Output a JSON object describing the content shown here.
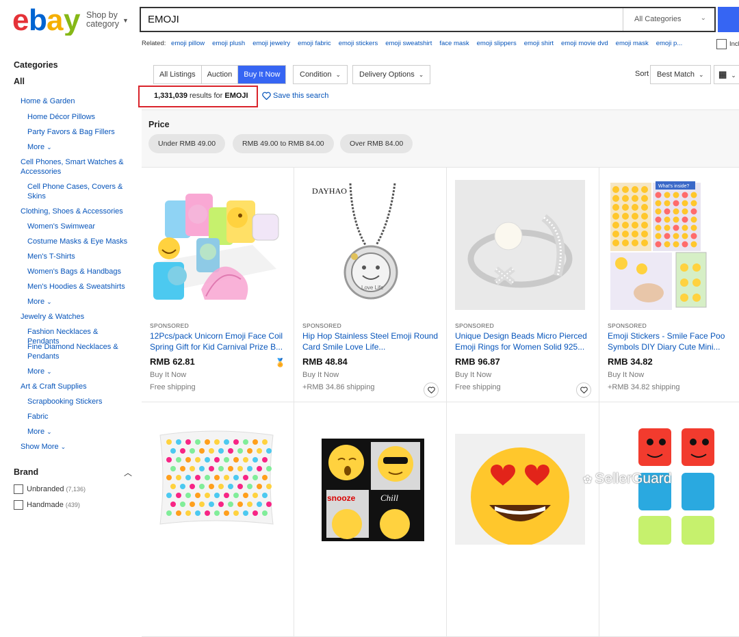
{
  "header": {
    "logo_letters": [
      "e",
      "b",
      "a",
      "y"
    ],
    "logo_colors": [
      "#e53238",
      "#0064d2",
      "#f5af02",
      "#86b817"
    ],
    "shop_by": "Shop by",
    "shop_by_2": "category",
    "search_value": "EMOJI",
    "category_select": "All Categories"
  },
  "related": {
    "label": "Related:",
    "links": [
      "emoji pillow",
      "emoji plush",
      "emoji jewelry",
      "emoji fabric",
      "emoji stickers",
      "emoji sweatshirt",
      "face mask",
      "emoji slippers",
      "emoji shirt",
      "emoji movie dvd",
      "emoji mask",
      "emoji p..."
    ],
    "include_label": "Incl"
  },
  "sidebar": {
    "categories_title": "Categories",
    "all": "All",
    "items": [
      {
        "label": "Home & Garden",
        "level": 1
      },
      {
        "label": "Home Décor Pillows",
        "level": 2
      },
      {
        "label": "Party Favors & Bag Fillers",
        "level": 2
      },
      {
        "label": "More",
        "level": 2,
        "more": true
      },
      {
        "label": "Cell Phones, Smart Watches & Accessories",
        "level": 1
      },
      {
        "label": "Cell Phone Cases, Covers & Skins",
        "level": 2
      },
      {
        "label": "Clothing, Shoes & Accessories",
        "level": 1
      },
      {
        "label": "Women's Swimwear",
        "level": 2
      },
      {
        "label": "Costume Masks & Eye Masks",
        "level": 2
      },
      {
        "label": "Men's T-Shirts",
        "level": 2
      },
      {
        "label": "Women's Bags & Handbags",
        "level": 2
      },
      {
        "label": "Men's Hoodies & Sweatshirts",
        "level": 2
      },
      {
        "label": "More",
        "level": 2,
        "more": true
      },
      {
        "label": "Jewelry & Watches",
        "level": 1
      },
      {
        "label": "Fashion Necklaces & Pendants",
        "level": 2
      },
      {
        "label": "Fine Diamond Necklaces & Pendants",
        "level": 2
      },
      {
        "label": "More",
        "level": 2,
        "more": true
      },
      {
        "label": "Art & Craft Supplies",
        "level": 1
      },
      {
        "label": "Scrapbooking Stickers",
        "level": 2
      },
      {
        "label": "Fabric",
        "level": 2
      },
      {
        "label": "More",
        "level": 2,
        "more": true
      },
      {
        "label": "Show More",
        "level": 1,
        "more": true
      }
    ],
    "brand_title": "Brand",
    "brands": [
      {
        "label": "Unbranded",
        "count": "(7,136)"
      },
      {
        "label": "Handmade",
        "count": "(439)"
      }
    ]
  },
  "filters": {
    "tabs": [
      "All Listings",
      "Auction",
      "Buy It Now"
    ],
    "active_tab": "Buy It Now",
    "condition": "Condition",
    "delivery": "Delivery Options",
    "sort_label": "Sort",
    "sort_value": "Best Match",
    "results_count": "1,331,039",
    "results_for": "results for",
    "results_query": "EMOJI",
    "save_search": "Save this search"
  },
  "price": {
    "title": "Price",
    "options": [
      "Under RMB 49.00",
      "RMB 49.00 to RMB 84.00",
      "Over RMB 84.00"
    ]
  },
  "listings": [
    {
      "sponsored": "SPONSORED",
      "title": "12Pcs/pack Unicorn Emoji Face Coil Spring Gift for Kid Carnival Prize B...",
      "price": "RMB 62.81",
      "format": "Buy It Now",
      "shipping": "Free shipping",
      "badge": true,
      "heart": false
    },
    {
      "sponsored": "SPONSORED",
      "title": "Hip Hop Stainless Steel Emoji Round Card Smile Love Life...",
      "price": "RMB 48.84",
      "format": "Buy It Now",
      "shipping": "+RMB 34.86 shipping",
      "badge": false,
      "heart": true
    },
    {
      "sponsored": "SPONSORED",
      "title": "Unique Design Beads Micro Pierced Emoji Rings for Women Solid 925...",
      "price": "RMB 96.87",
      "format": "Buy It Now",
      "shipping": "Free shipping",
      "badge": false,
      "heart": true
    },
    {
      "sponsored": "SPONSORED",
      "title": "Emoji Stickers - Smile Face Poo Symbols DIY Diary Cute Mini...",
      "price": "RMB 34.82",
      "format": "Buy It Now",
      "shipping": "+RMB 34.82 shipping",
      "badge": false,
      "heart": false
    }
  ],
  "product_images": {
    "dayhao_brand": "DAYHAO",
    "love_life": "Love Life",
    "snooze": "snooze",
    "chill": "Chill",
    "whats_inside": "What's inside?"
  },
  "watermark": "SellerGuard"
}
